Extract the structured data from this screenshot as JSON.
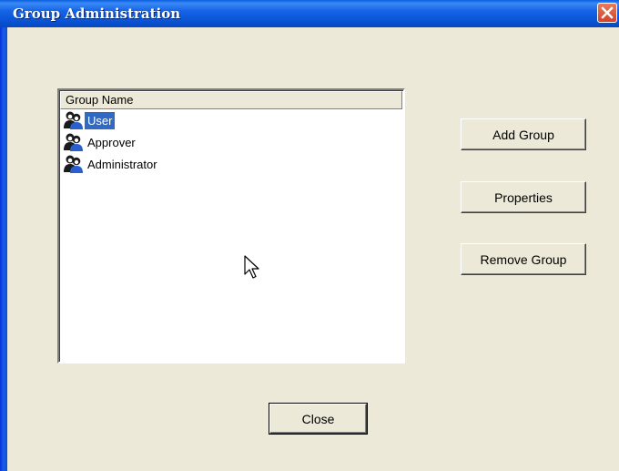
{
  "window": {
    "title": "Group Administration"
  },
  "listview": {
    "column_header": "Group Name",
    "items": [
      {
        "label": "User",
        "icon": "group-users-icon",
        "selected": true
      },
      {
        "label": "Approver",
        "icon": "group-users-icon",
        "selected": false
      },
      {
        "label": "Administrator",
        "icon": "group-users-icon",
        "selected": false
      }
    ]
  },
  "buttons": {
    "add_group": "Add Group",
    "properties": "Properties",
    "remove_group": "Remove Group",
    "close": "Close"
  },
  "colors": {
    "titlebar": "#0a54d6",
    "selection": "#316ac5",
    "dialog_bg": "#ece9d8"
  }
}
